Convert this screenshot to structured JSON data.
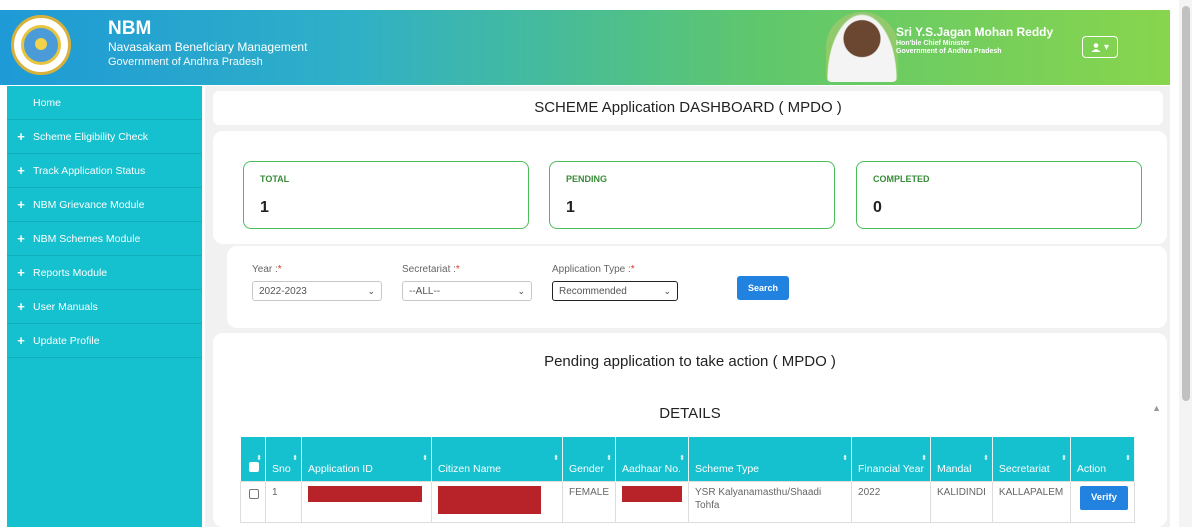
{
  "header": {
    "app_abbr": "NBM",
    "app_name": "Navasakam Beneficiary Management",
    "government": "Government of Andhra Pradesh",
    "cm_name": "Sri Y.S.Jagan Mohan Reddy",
    "cm_title": "Hon'ble Chief Minister",
    "cm_government": "Government of Andhra Pradesh",
    "user_menu_icon": "user-icon"
  },
  "sidebar": {
    "items": [
      {
        "label": "Home"
      },
      {
        "label": "Scheme Eligibility Check"
      },
      {
        "label": "Track Application Status"
      },
      {
        "label": "NBM Grievance Module"
      },
      {
        "label": "NBM Schemes Module"
      },
      {
        "label": "Reports Module"
      },
      {
        "label": "User Manuals"
      },
      {
        "label": "Update Profile"
      }
    ]
  },
  "dashboard": {
    "title": "SCHEME Application DASHBOARD ( MPDO )",
    "stats": [
      {
        "label": "TOTAL",
        "value": "1"
      },
      {
        "label": "PENDING",
        "value": "1"
      },
      {
        "label": "COMPLETED",
        "value": "0"
      }
    ]
  },
  "filters": {
    "year": {
      "label": "Year :",
      "required": "*",
      "value": "2022-2023"
    },
    "secretariat": {
      "label": "Secretariat :",
      "required": "*",
      "value": "--ALL--"
    },
    "application_type": {
      "label": "Application Type :",
      "required": "*",
      "value": "Recommended"
    },
    "search_label": "Search"
  },
  "pending": {
    "title": "Pending application to take action ( MPDO )",
    "details_label": "DETAILS",
    "columns": [
      "Sno",
      "Application ID",
      "Citizen Name",
      "Gender",
      "Aadhaar No.",
      "Scheme Type",
      "Financial Year",
      "Mandal",
      "Secretariat",
      "Action"
    ],
    "rows": [
      {
        "sno": "1",
        "application_id": "",
        "citizen_name": "",
        "gender": "FEMALE",
        "aadhaar": "",
        "scheme_type": "YSR Kalyanamasthu/Shaadi Tohfa",
        "financial_year": "2022",
        "mandal": "KALIDINDI",
        "secretariat": "KALLAPALEM",
        "action_label": "Verify"
      }
    ]
  },
  "colors": {
    "sidebar": "#15c0cf",
    "header_start": "#1e9ad6",
    "header_end": "#88d54d",
    "button": "#2182e0",
    "stat_border": "#4bbd5b",
    "redaction": "#b8232a"
  }
}
